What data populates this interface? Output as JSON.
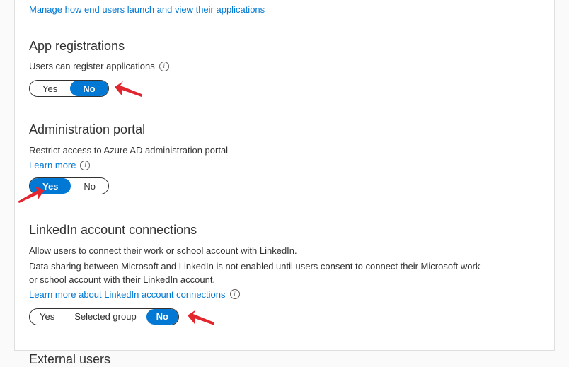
{
  "top_link": "Manage how end users launch and view their applications",
  "sections": {
    "app_registrations": {
      "title": "App registrations",
      "label": "Users can register applications",
      "toggle": {
        "yes": "Yes",
        "no": "No"
      }
    },
    "admin_portal": {
      "title": "Administration portal",
      "label": "Restrict access to Azure AD administration portal",
      "learn_more": "Learn more",
      "toggle": {
        "yes": "Yes",
        "no": "No"
      }
    },
    "linkedin": {
      "title": "LinkedIn account connections",
      "desc1": "Allow users to connect their work or school account with LinkedIn.",
      "desc2": "Data sharing between Microsoft and LinkedIn is not enabled until users consent to connect their Microsoft work or school account with their LinkedIn account.",
      "learn_more": "Learn more about LinkedIn account connections",
      "toggle": {
        "yes": "Yes",
        "selected_group": "Selected group",
        "no": "No"
      }
    },
    "external_users": {
      "title": "External users"
    }
  }
}
